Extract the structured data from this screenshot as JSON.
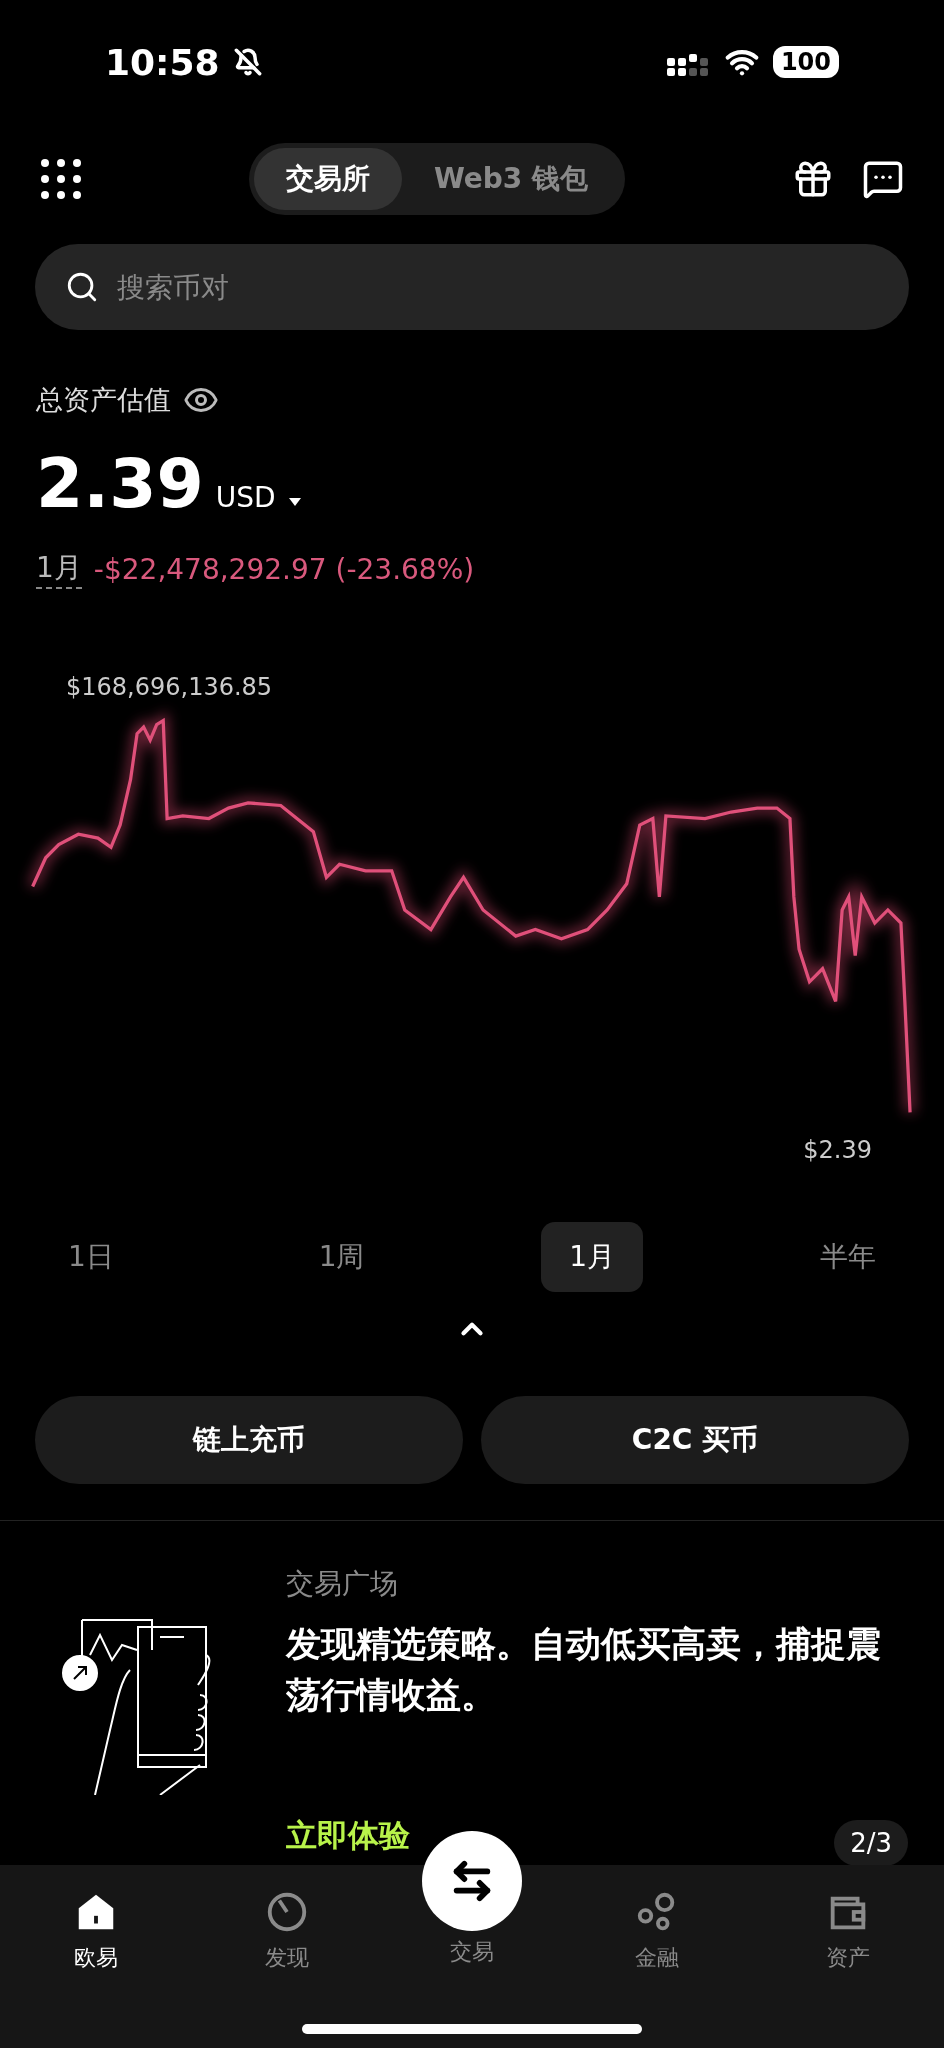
{
  "status_bar": {
    "time": "10:58",
    "battery": "100"
  },
  "header": {
    "segments": [
      {
        "label": "交易所",
        "selected": true
      },
      {
        "label": "Web3 钱包",
        "selected": false
      }
    ]
  },
  "search": {
    "placeholder": "搜索币对"
  },
  "assets": {
    "label": "总资产估值",
    "value": "2.39",
    "currency": "USD",
    "period": "1月",
    "change": "-$22,478,292.97 (-23.68%)"
  },
  "chart": {
    "max_label": "$168,696,136.85",
    "min_label": "$2.39"
  },
  "periods": [
    {
      "label": "1日",
      "selected": false
    },
    {
      "label": "1周",
      "selected": false
    },
    {
      "label": "1月",
      "selected": true
    },
    {
      "label": "半年",
      "selected": false
    }
  ],
  "actions": [
    "链上充币",
    "C2C 买币"
  ],
  "banner": {
    "category": "交易广场",
    "text": "发现精选策略。自动低买高卖，捕捉震荡行情收益。",
    "cta": "立即体验",
    "pager": "2/3"
  },
  "nav": [
    {
      "label": "欧易",
      "kind": "home",
      "selected": true
    },
    {
      "label": "发现",
      "kind": "discover",
      "selected": false
    },
    {
      "label": "交易",
      "kind": "trade",
      "selected": false
    },
    {
      "label": "金融",
      "kind": "finance",
      "selected": false
    },
    {
      "label": "资产",
      "kind": "assets",
      "selected": false
    }
  ]
}
